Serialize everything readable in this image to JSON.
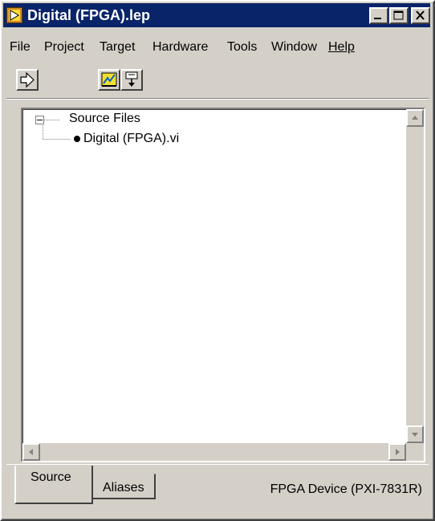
{
  "window": {
    "title": "Digital (FPGA).lep"
  },
  "menu": {
    "items": [
      "File",
      "Project",
      "Target",
      "Hardware",
      "Tools",
      "Window",
      "Help"
    ]
  },
  "tree": {
    "root_label": "Source Files",
    "child_label": "Digital (FPGA).vi"
  },
  "tabs": {
    "active": "Source",
    "inactive": "Aliases"
  },
  "status": {
    "device": "FPGA Device (PXI-7831R)"
  },
  "colors": {
    "titlebar": "#0a246a",
    "face": "#d4d0c8"
  },
  "icons": {
    "app": "labview-fpga-icon",
    "run": "run-arrow-icon",
    "compile": "compile-icon",
    "download": "download-icon"
  }
}
